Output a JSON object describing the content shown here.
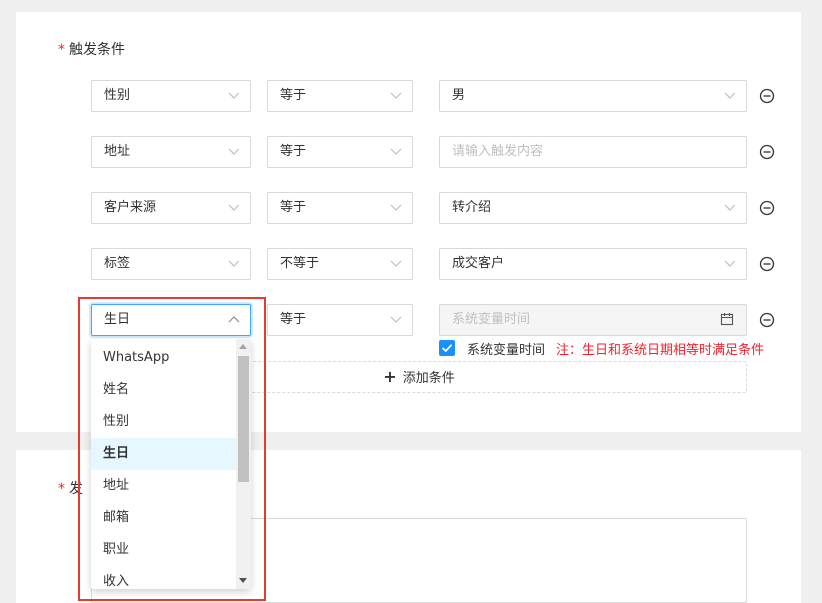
{
  "trigger": {
    "label": "触发条件",
    "rows": [
      {
        "field": "性别",
        "operator": "等于",
        "value": "男",
        "value_kind": "select"
      },
      {
        "field": "地址",
        "operator": "等于",
        "value": "",
        "placeholder": "请输入触发内容",
        "value_kind": "input"
      },
      {
        "field": "客户来源",
        "operator": "等于",
        "value": "转介绍",
        "value_kind": "select"
      },
      {
        "field": "标签",
        "operator": "不等于",
        "value": "成交客户",
        "value_kind": "select"
      },
      {
        "field": "生日",
        "operator": "等于",
        "value": "",
        "placeholder": "系统变量时间",
        "value_kind": "date-disabled",
        "open": true
      }
    ],
    "checkbox_label": "系统变量时间",
    "checkbox_checked": true,
    "note": "注：生日和系统日期相等时满足条件",
    "add_condition": "添加条件"
  },
  "send": {
    "label_fragment": "发"
  },
  "dropdown": {
    "options": [
      "WhatsApp",
      "姓名",
      "性别",
      "生日",
      "地址",
      "邮箱",
      "职业",
      "收入"
    ],
    "selected": "生日"
  },
  "colors": {
    "primary": "#1890ff",
    "required": "#f5222d",
    "highlight": "#e53935"
  }
}
